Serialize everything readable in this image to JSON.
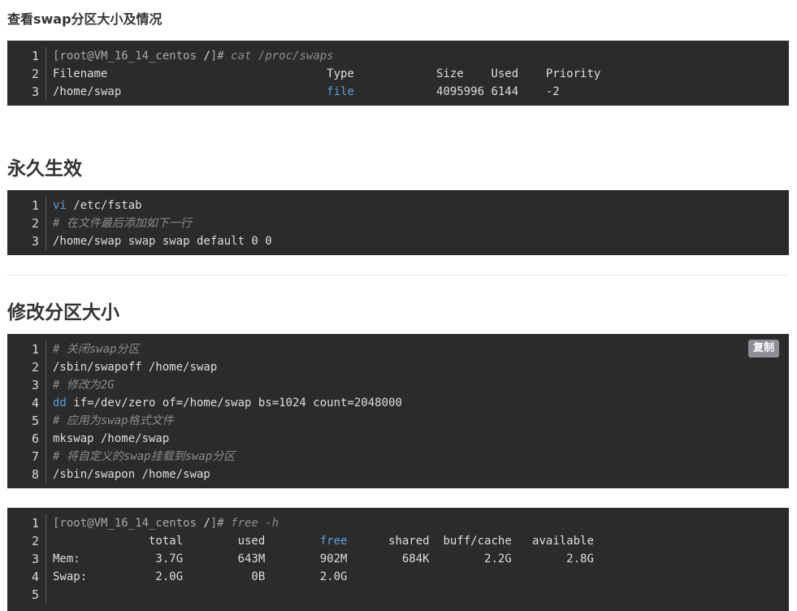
{
  "sections": {
    "swap_check_title": "查看swap分区大小及情况",
    "permanent_title": "永久生效",
    "resize_title": "修改分区大小"
  },
  "blocks": [
    {
      "lines": [
        [
          {
            "t": "[root@VM_16_14_centos ",
            "s": "muted"
          },
          {
            "t": "/",
            "s": "plain"
          },
          {
            "t": "]# ",
            "s": "muted"
          },
          {
            "t": "cat /proc/swaps",
            "s": "comment"
          }
        ],
        [
          {
            "t": "Filename                                Type            Size    Used    Priority",
            "s": "plain"
          }
        ],
        [
          {
            "t": "/home/swap                              ",
            "s": "plain"
          },
          {
            "t": "file",
            "s": "kw"
          },
          {
            "t": "            4095996 6144    -2",
            "s": "plain"
          }
        ]
      ]
    },
    {
      "lines": [
        [
          {
            "t": "vi",
            "s": "kw"
          },
          {
            "t": " /etc/fstab",
            "s": "plain"
          }
        ],
        [
          {
            "t": "# 在文件最后添加如下一行",
            "s": "comment"
          }
        ],
        [
          {
            "t": "/home/swap swap swap default 0 0",
            "s": "plain"
          }
        ]
      ]
    },
    {
      "copy_label": "复制",
      "lines": [
        [
          {
            "t": "# 关闭swap分区",
            "s": "comment"
          }
        ],
        [
          {
            "t": "/sbin/swapoff /home/swap",
            "s": "plain"
          }
        ],
        [
          {
            "t": "# 修改为2G",
            "s": "comment"
          }
        ],
        [
          {
            "t": "dd",
            "s": "kw"
          },
          {
            "t": " if=/dev/zero of=/home/swap bs=1024 count=2048000",
            "s": "plain"
          }
        ],
        [
          {
            "t": "# 应用为swap格式文件",
            "s": "comment"
          }
        ],
        [
          {
            "t": "mkswap /home/swap",
            "s": "plain"
          }
        ],
        [
          {
            "t": "# 将自定义的swap挂载到swap分区",
            "s": "comment"
          }
        ],
        [
          {
            "t": "/sbin/swapon /home/swap",
            "s": "plain"
          }
        ]
      ]
    },
    {
      "lines": [
        [
          {
            "t": "[root@VM_16_14_centos ",
            "s": "muted"
          },
          {
            "t": "/",
            "s": "plain"
          },
          {
            "t": "]# ",
            "s": "muted"
          },
          {
            "t": "free -h",
            "s": "comment"
          }
        ],
        [
          {
            "t": "              total        used        ",
            "s": "plain"
          },
          {
            "t": "free",
            "s": "kw"
          },
          {
            "t": "      shared  buff/cache   available",
            "s": "plain"
          }
        ],
        [
          {
            "t": "Mem:           3.7G        643M        902M        684K        2.2G        2.8G",
            "s": "plain"
          }
        ],
        [
          {
            "t": "Swap:          2.0G          0B        2.0G",
            "s": "plain"
          }
        ],
        [
          {
            "t": "",
            "s": "plain"
          }
        ]
      ]
    }
  ]
}
